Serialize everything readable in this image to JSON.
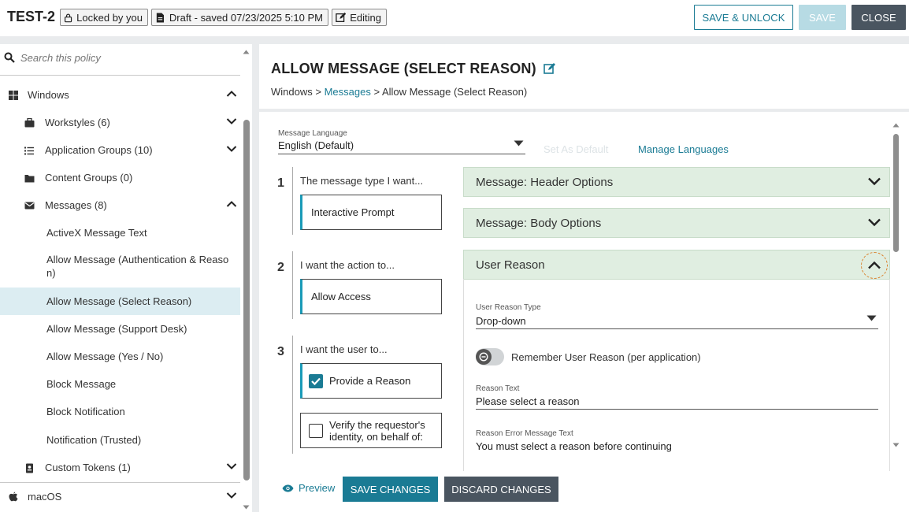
{
  "header": {
    "policy_name": "TEST-2",
    "locked_label": "Locked by you",
    "draft_label": "Draft - saved 07/23/2025 5:10 PM",
    "editing_label": "Editing",
    "save_unlock_label": "SAVE & UNLOCK",
    "save_label": "SAVE",
    "close_label": "CLOSE"
  },
  "sidebar": {
    "search_placeholder": "Search this policy",
    "items": [
      {
        "label": "Windows",
        "icon": "windows-icon"
      },
      {
        "label": "Workstyles (6)",
        "icon": "briefcase-icon"
      },
      {
        "label": "Application Groups (10)",
        "icon": "list-icon"
      },
      {
        "label": "Content Groups (0)",
        "icon": "folder-icon"
      },
      {
        "label": "Messages (8)",
        "icon": "envelope-icon"
      },
      {
        "label": "ActiveX Message Text"
      },
      {
        "label": "Allow Message (Authentication & Reaso",
        "label2": "n)"
      },
      {
        "label": "Allow Message (Select Reason)"
      },
      {
        "label": "Allow Message (Support Desk)"
      },
      {
        "label": "Allow Message (Yes / No)"
      },
      {
        "label": "Block Message"
      },
      {
        "label": "Block Notification"
      },
      {
        "label": "Notification (Trusted)"
      },
      {
        "label": "Custom Tokens (1)",
        "icon": "token-icon"
      },
      {
        "label": "macOS",
        "icon": "apple-icon"
      }
    ]
  },
  "main": {
    "title": "ALLOW MESSAGE (SELECT REASON)",
    "breadcrumb": {
      "part1": "Windows",
      "sep": " > ",
      "link": "Messages",
      "part3": "Allow Message (Select Reason)"
    },
    "message_language": {
      "label": "Message Language",
      "value": "English (Default)"
    },
    "set_as_default": "Set As Default",
    "manage_languages": "Manage Languages",
    "steps": [
      {
        "num": "1",
        "label": "The message type I want...",
        "value": "Interactive Prompt"
      },
      {
        "num": "2",
        "label": "I want the action to...",
        "value": "Allow Access"
      },
      {
        "num": "3",
        "label": "I want the user to...",
        "option1": "Provide a Reason",
        "option2_line1": "Verify the requestor's",
        "option2_line2": "identity, on behalf of:"
      }
    ],
    "accordions": {
      "header_options": "Message: Header Options",
      "body_options": "Message: Body Options",
      "user_reason": "User Reason"
    },
    "user_reason": {
      "type_label": "User Reason Type",
      "type_value": "Drop-down",
      "remember_label": "Remember User Reason (per application)",
      "reason_text_label": "Reason Text",
      "reason_text_value": "Please select a reason",
      "error_label": "Reason Error Message Text",
      "error_value": "You must select a reason before continuing"
    }
  },
  "footer": {
    "preview_label": "Preview",
    "save_changes_label": "SAVE CHANGES",
    "discard_changes_label": "DISCARD CHANGES"
  },
  "colors": {
    "accent": "#1a7b94",
    "accordion_bg": "#e0eee1",
    "selected_bg": "#dcedf2",
    "dark_button": "#4a5560"
  }
}
